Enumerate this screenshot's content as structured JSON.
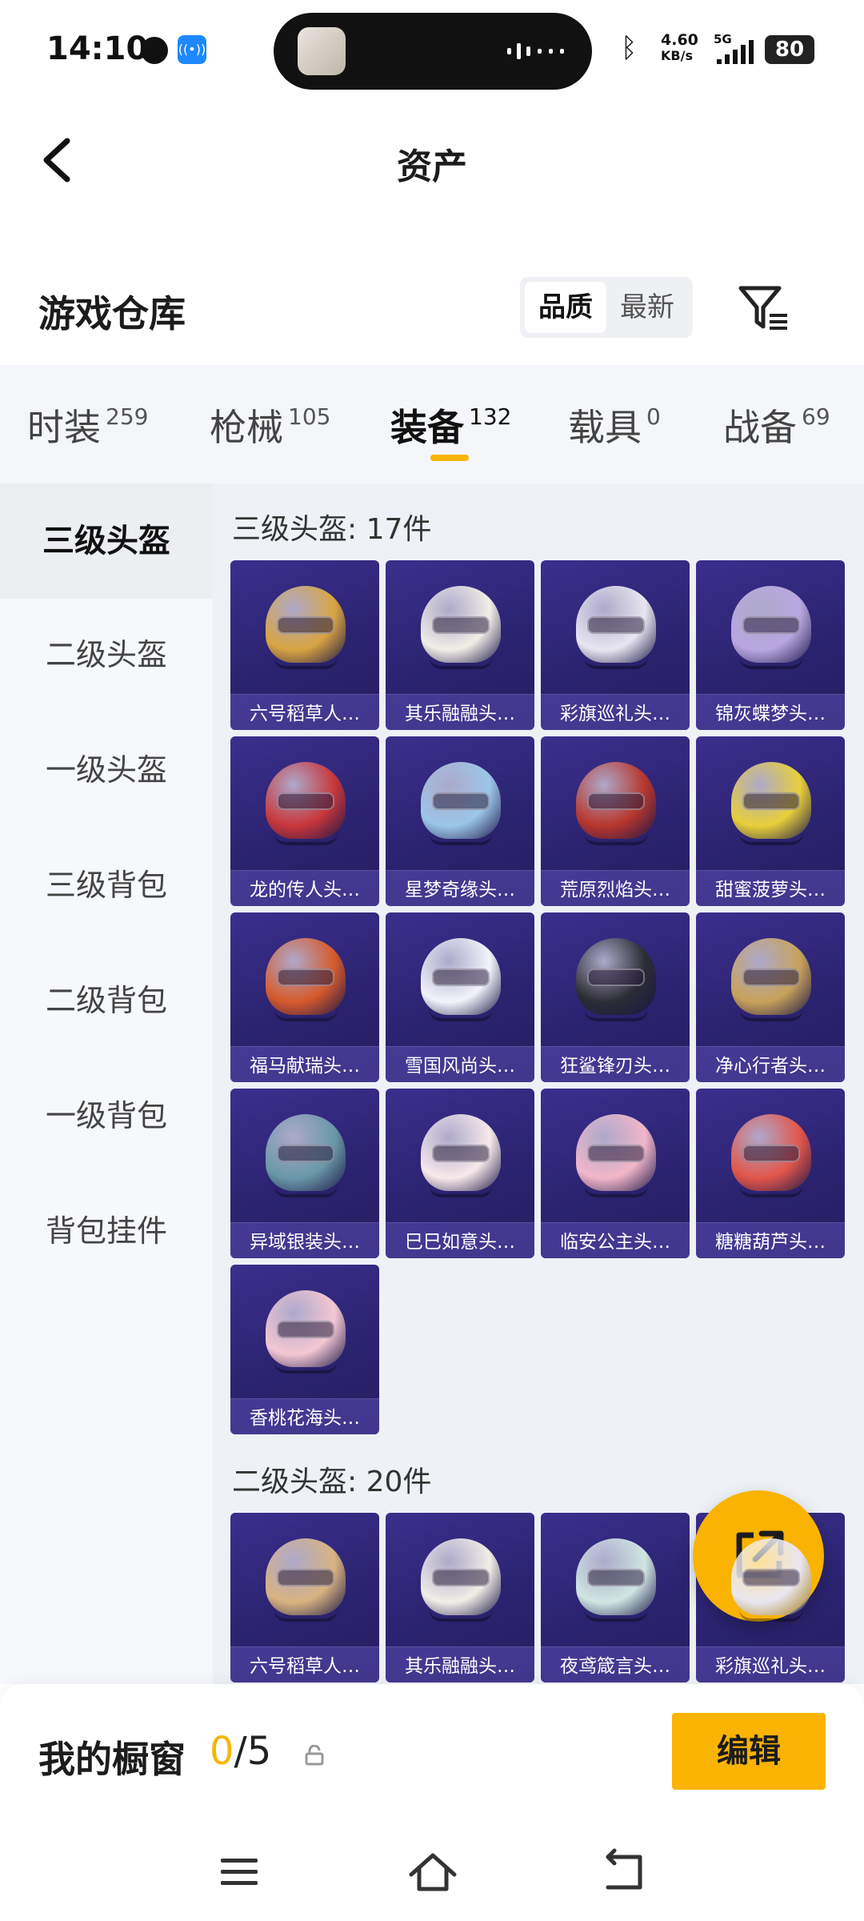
{
  "status_bar": {
    "time": "14:10",
    "speed_top": "4.60",
    "speed_bottom": "KB/s",
    "network": "5G",
    "battery": "80"
  },
  "header": {
    "title": "资产",
    "back_icon": "chevron-left-icon"
  },
  "warehouse": {
    "title": "游戏仓库",
    "sort_options": [
      "品质",
      "最新"
    ],
    "sort_selected": "品质",
    "filter_icon": "filter-icon"
  },
  "tabs": [
    {
      "label": "时装",
      "count": "259"
    },
    {
      "label": "枪械",
      "count": "105"
    },
    {
      "label": "装备",
      "count": "132"
    },
    {
      "label": "载具",
      "count": "0"
    },
    {
      "label": "战备",
      "count": "69"
    }
  ],
  "active_tab": "装备",
  "sidebar": {
    "items": [
      "三级头盔",
      "二级头盔",
      "一级头盔",
      "三级背包",
      "二级背包",
      "一级背包",
      "背包挂件"
    ],
    "active": "三级头盔"
  },
  "sections": [
    {
      "title": "三级头盔: 17件",
      "items": [
        "六号稻草人…",
        "其乐融融头…",
        "彩旗巡礼头…",
        "锦灰蝶梦头…",
        "龙的传人头…",
        "星梦奇缘头…",
        "荒原烈焰头…",
        "甜蜜菠萝头…",
        "福马献瑞头…",
        "雪国风尚头…",
        "狂鲨锋刃头…",
        "净心行者头…",
        "异域银装头…",
        "巳巳如意头…",
        "临安公主头…",
        "糖糖葫芦头…",
        "香桃花海头…"
      ]
    },
    {
      "title": "二级头盔: 20件",
      "items": [
        "六号稻草人…",
        "其乐融融头…",
        "夜鸢箴言头…",
        "彩旗巡礼头…"
      ]
    }
  ],
  "showcase": {
    "label": "我的橱窗",
    "count": "0",
    "total": "/5",
    "edit_label": "编辑"
  },
  "colors": {
    "accent": "#f9b300",
    "card_bg": "#2b2370"
  }
}
